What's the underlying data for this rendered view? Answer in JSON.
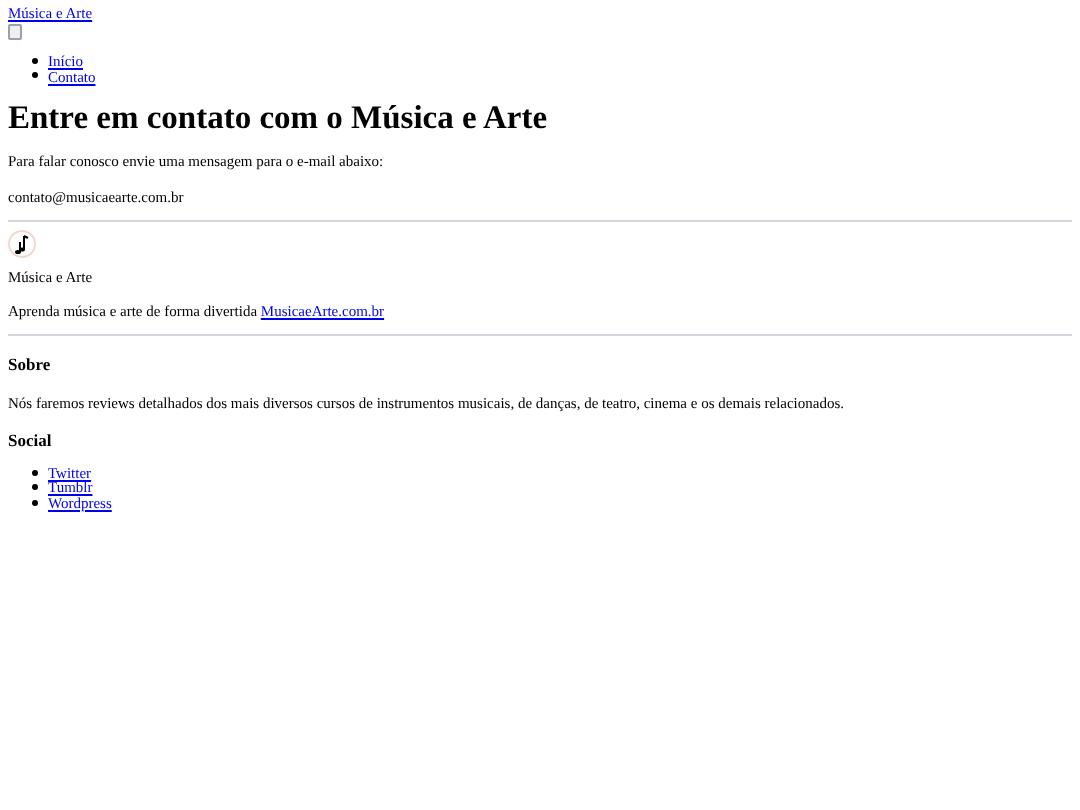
{
  "brand": "Música e Arte",
  "nav": [
    "Início",
    "Contato"
  ],
  "heading": "Entre em contato com o Música e Arte",
  "intro": "Para falar conosco envie uma mensagem para o e-mail abaixo:",
  "email": "contato@musicaearte.com.br",
  "footer": {
    "name": "Música e Arte",
    "tagline": "Aprenda música e arte de forma divertida",
    "site_link": "MusicaeArte.com.br"
  },
  "about": {
    "title": "Sobre",
    "text": "Nós faremos reviews detalhados dos mais diversos cursos de instrumentos musicais, de danças, de teatro, cinema e os demais relacionados."
  },
  "social": {
    "title": "Social",
    "links": [
      "Twitter",
      "Tumblr",
      "Wordpress"
    ]
  }
}
